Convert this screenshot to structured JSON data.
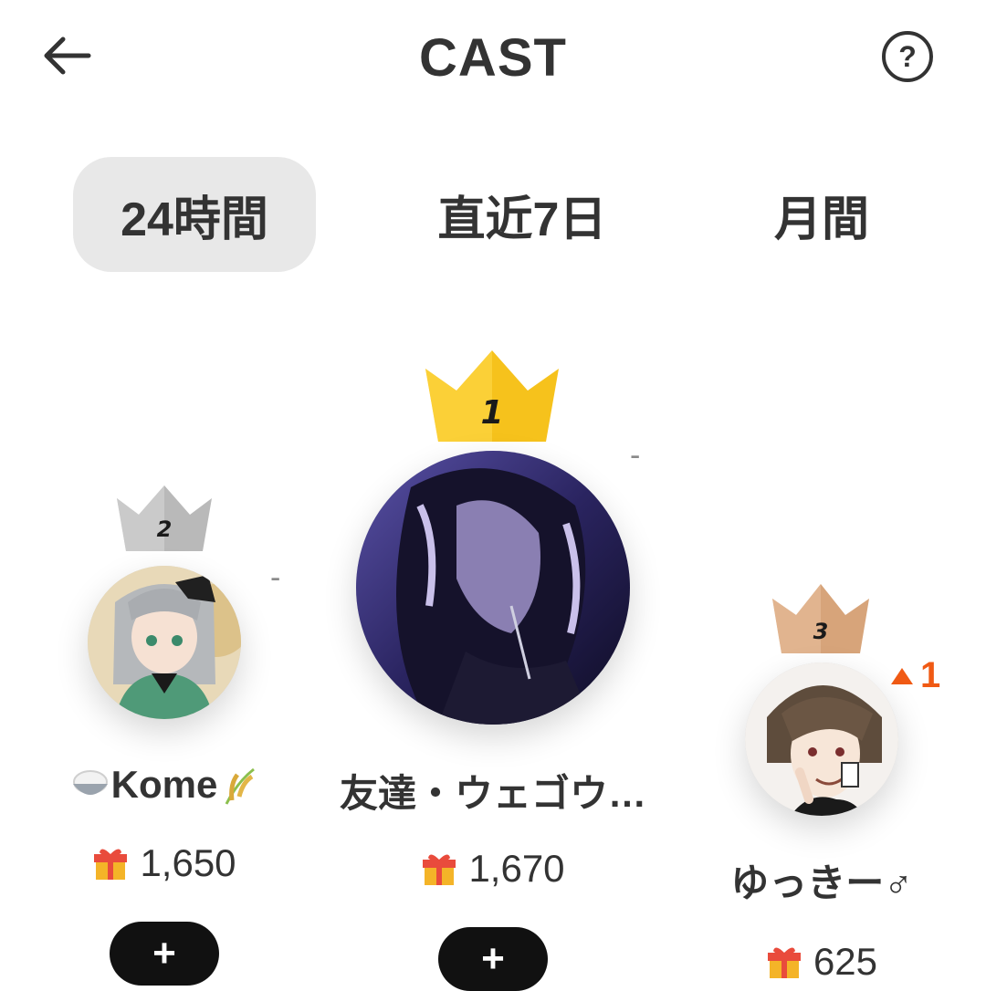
{
  "header": {
    "title": "CAST",
    "back_icon": "arrow-left-icon",
    "help_icon": "question-circle-icon",
    "help_label": "?"
  },
  "tabs": [
    {
      "label": "24時間",
      "active": true
    },
    {
      "label": "直近7日",
      "active": false
    },
    {
      "label": "月間",
      "active": false
    }
  ],
  "ranking": [
    {
      "rank": "1",
      "crown_color": "#f6c21c",
      "name": "友達・ウェゴウ…",
      "gifts": "1,670",
      "change": "-",
      "follow_label": "+"
    },
    {
      "rank": "2",
      "crown_color": "#b9b9b9",
      "name": "Kome",
      "name_prefix_icon": "rice-bowl-icon",
      "name_suffix_icon": "rice-plant-icon",
      "gifts": "1,650",
      "change": "-",
      "follow_label": "+"
    },
    {
      "rank": "3",
      "crown_color": "#d7a47a",
      "name": "ゆっきー♂",
      "gifts": "625",
      "change": "1",
      "change_direction": "up",
      "change_color": "#f05a14"
    }
  ],
  "gift_icon": "gift-icon"
}
